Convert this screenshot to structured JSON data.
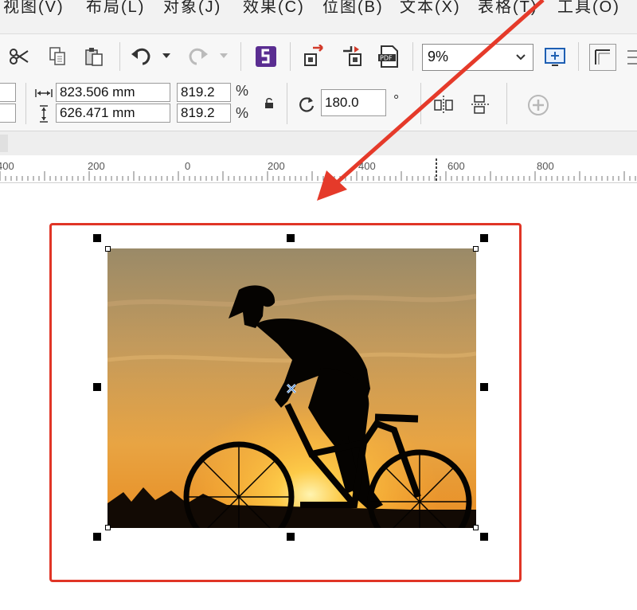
{
  "menubar": {
    "items": [
      "视图(V)",
      "布局(L)",
      "对象(J)",
      "效果(C)",
      "位图(B)",
      "文本(X)",
      "表格(T)",
      "工具(O)"
    ]
  },
  "toolbar": {
    "zoom_value": "9%",
    "icons": [
      "cut-icon",
      "copy-icon",
      "paste-icon",
      "undo-icon",
      "redo-icon",
      "corel-connect-icon",
      "import-icon",
      "export-icon",
      "pdf-icon",
      "full-screen-icon",
      "snap-icon"
    ]
  },
  "propertybar": {
    "width_value": "823.506 mm",
    "height_value": "626.471 mm",
    "scale_x": "819.2",
    "scale_y": "819.2",
    "percent": "%",
    "rotation": "180.0",
    "degree": "°"
  },
  "ruler": {
    "labels": [
      "400",
      "200",
      "0",
      "200",
      "400",
      "600",
      "800"
    ]
  },
  "colors": {
    "highlight": "#e03526",
    "arrow": "#e53a2a",
    "accent": "#5a2d91"
  }
}
